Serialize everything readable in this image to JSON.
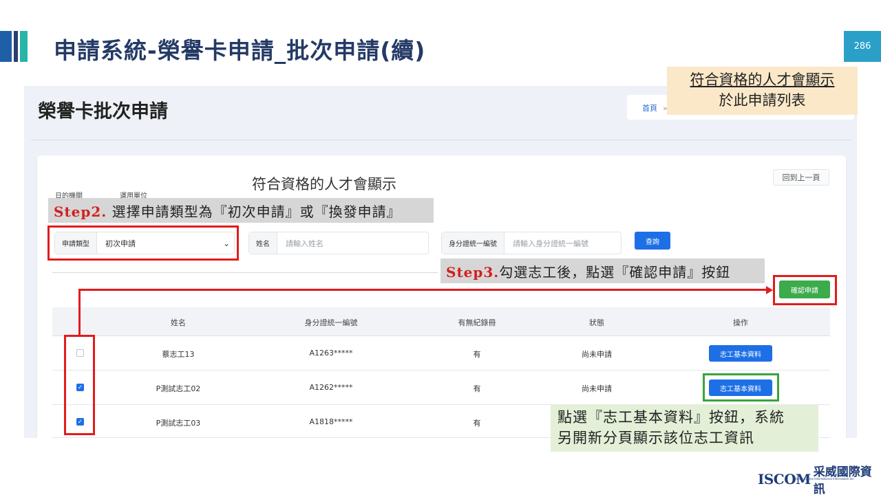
{
  "slide": {
    "title": "申請系統-榮譽卡申請_批次申請(續)",
    "page_number": "286"
  },
  "app": {
    "page_title": "榮譽卡批次申請",
    "breadcrumb_home": "首頁",
    "breadcrumb_sep": "»",
    "filter_label_date": "日的機關",
    "filter_label_unit": "運用單位",
    "back_label": "回到上一頁",
    "apply_type": {
      "label": "申請類型",
      "value": "初次申請"
    },
    "name_field": {
      "label": "姓名",
      "placeholder": "請輸入姓名"
    },
    "id_field": {
      "label": "身分證統一編號",
      "placeholder": "請輸入身分證統一編號"
    },
    "search_label": "查詢",
    "confirm_label": "確認申請",
    "table": {
      "headers": [
        "姓名",
        "身分證統一編號",
        "有無紀錄冊",
        "狀態",
        "操作"
      ],
      "rows": [
        {
          "checked": false,
          "name": "蔡志工13",
          "id": "A1263*****",
          "record": "有",
          "status": "尚未申請",
          "action": "志工基本資料"
        },
        {
          "checked": true,
          "name": "P測試志工02",
          "id": "A1262*****",
          "record": "有",
          "status": "尚未申請",
          "action": "志工基本資料"
        },
        {
          "checked": true,
          "name": "P測試志工03",
          "id": "A1818*****",
          "record": "有",
          "status": "",
          "action": ""
        }
      ]
    }
  },
  "annotations": {
    "caption": "符合資格的人才會顯示",
    "step2_prefix": "Step2.",
    "step2_text": " 選擇申請類型為『初次申請』或『換發申請』",
    "step3_prefix": "Step3.",
    "step3_text": "勾選志工後，點選『確認申請』按鈕",
    "yellow_line1": "符合資格的人才會顯示",
    "yellow_line2": "於此申請列表",
    "green_line1": "點選『志工基本資料』按鈕，系統",
    "green_line2": "另開新分頁顯示該位志工資訊"
  },
  "logo": {
    "en": "ISCOM",
    "zh": "采威國際資訊",
    "sub": "Iscom Online International Information Inc."
  },
  "colors": {
    "title": "#243a66",
    "accent_blue": "#1d6fe6",
    "accent_green": "#3bab4b",
    "highlight_red": "#e31b1b",
    "highlight_green": "#38a43a"
  }
}
